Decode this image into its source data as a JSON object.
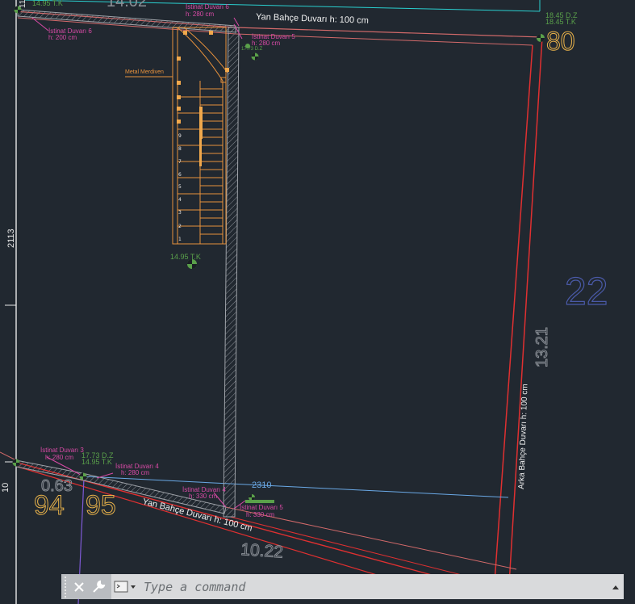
{
  "labels": {
    "tk_top_left": "14.95 T.K",
    "dim_top_partial": "14.02",
    "dim_left_top_partial": "11",
    "istinat6_title_left": "İstinat Duvarı 6",
    "istinat6_h_left": "h: 200 cm",
    "istinat6_title_top": "İstinat Duvarı 6",
    "istinat6_h_top": "h: 280 cm",
    "istinat5_title_top": "İstinat Duvarı 5",
    "istinat5_h_top": "h: 280 cm",
    "dz_small": "17.73 D.Z",
    "yan_bahce_top": "Yan Bahçe Duvarı h: 100 cm",
    "dz_right": "18.45 D.Z",
    "tk_right": "18.45 T.K",
    "big_80": "80",
    "metal_merdiven": "Metal Merdiven",
    "dim_2113": "2113",
    "tk_mid": "14.95 T.K",
    "big_22": "22",
    "dim_1321": "13.21",
    "arka_bahce": "Arka Bahçe Duvarı h: 100 cm",
    "istinat3_title": "İstinat Duvarı 3",
    "istinat3_h": "h: 280 cm",
    "dz_bottom": "17.73 D.Z",
    "tk_bottom": "14.95 T.K",
    "istinat4_title": "İstinat Duvarı 4",
    "istinat4_h": "h: 280 cm",
    "istinat4b_title": "İstinat Duvarı 4",
    "istinat4b_h": "h: 330 cm",
    "istinat5b_title": "İstinat Duvarı 5",
    "istinat5b_h": "h: 330 cm",
    "dim_2310": "2310",
    "dim_063": "0.63",
    "big_94": "94",
    "big_95": "95",
    "yan_bahce_bottom": "Yan Bahçe Duvarı h: 100 cm",
    "dim_1022": "10.22",
    "dim_10": "10"
  },
  "stair_numbers": [
    "1",
    "2",
    "3",
    "4",
    "5",
    "6",
    "7",
    "8",
    "9"
  ],
  "command_line": {
    "placeholder": "Type a command"
  },
  "icons": {
    "close": "close-icon",
    "settings": "wrench-icon",
    "prompt": "command-prompt-icon",
    "history": "chevron-up-icon"
  }
}
